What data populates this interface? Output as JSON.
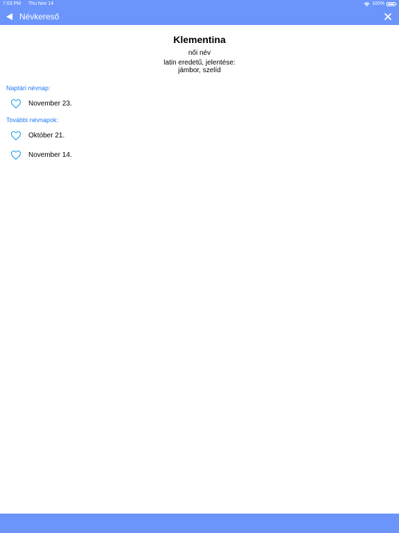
{
  "status_bar": {
    "time": "7:03 PM",
    "date": "Thu Nov 14",
    "battery": "100%"
  },
  "nav": {
    "back_label": "Névkereső",
    "back_icon": "back-arrow-icon",
    "close_icon": "close-icon"
  },
  "name": {
    "title": "Klementina",
    "gender": "női név",
    "origin_line1": "latin eredetű, jelentése:",
    "origin_line2": "jámbor, szelíd"
  },
  "calendar_section": {
    "label": "Naptári névnap:",
    "dates": [
      "November 23."
    ]
  },
  "other_section": {
    "label": "További névnapok:",
    "dates": [
      "Október 21.",
      "November 14."
    ]
  },
  "colors": {
    "header_bg": "#6b95fb",
    "accent": "#1f7bf6",
    "heart": "#1f9bf0"
  }
}
